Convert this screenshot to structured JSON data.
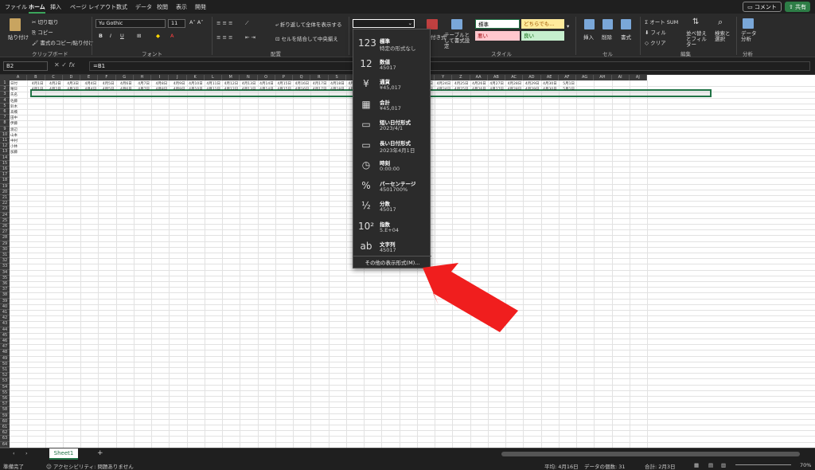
{
  "menu": {
    "tabs": [
      "ファイル",
      "ホーム",
      "挿入",
      "ページ レイアウト",
      "数式",
      "データ",
      "校閲",
      "表示",
      "開発"
    ],
    "active": "ホーム"
  },
  "top_right": {
    "comment": "コメント",
    "share": "共有"
  },
  "ribbon": {
    "clipboard": {
      "paste": "貼り付け",
      "cut": "切り取り",
      "copy": "コピー",
      "format_painter": "書式のコピー/貼り付け",
      "label": "クリップボード"
    },
    "font": {
      "name": "Yu Gothic",
      "size": "11",
      "label": "フォント"
    },
    "alignment": {
      "wrap": "折り返して全体を表示する",
      "merge": "セルを結合して中央揃え",
      "label": "配置"
    },
    "styles": {
      "cond_format_tail": "付き式",
      "table_format": "テーブルとして書式設定",
      "standard": "標準",
      "neutral": "どちらでも...",
      "bad": "悪い",
      "good": "良い",
      "label": "スタイル"
    },
    "cells": {
      "insert": "挿入",
      "delete": "削除",
      "format": "書式",
      "label": "セル"
    },
    "editing": {
      "autosum": "オート SUM",
      "fill": "フィル",
      "clear": "クリア",
      "sort": "並べ替えとフィルター",
      "find": "検索と選択",
      "label": "編集"
    },
    "analysis": {
      "data_analysis": "データ分析",
      "label": "分析"
    }
  },
  "formula_bar": {
    "name_box": "B2",
    "fx": "fx",
    "formula": "=B1"
  },
  "grid": {
    "columns": [
      "A",
      "B",
      "C",
      "D",
      "E",
      "F",
      "G",
      "H",
      "I",
      "J",
      "K",
      "L",
      "M",
      "N",
      "O",
      "P",
      "Q",
      "R",
      "S",
      "T",
      "U",
      "V",
      "W",
      "X",
      "Y",
      "Z",
      "AA",
      "AB",
      "AC",
      "AD",
      "AE",
      "AF",
      "AG",
      "AH",
      "AI",
      "AJ"
    ],
    "dates": [
      "4月1日",
      "4月2日",
      "4月3日",
      "4月4日",
      "4月5日",
      "4月6日",
      "4月7日",
      "4月8日",
      "4月9日",
      "4月10日",
      "4月11日",
      "4月12日",
      "4月13日",
      "4月14日",
      "4月15日",
      "4月16日",
      "4月17日",
      "4月18日",
      "4月19日",
      "4月20日",
      "4月21日",
      "4月22日",
      "4月23日",
      "4月24日",
      "4月25日",
      "4月26日",
      "4月27日",
      "4月28日",
      "4月29日",
      "4月30日",
      "5月1日"
    ],
    "row_labels": [
      "日付",
      "曜日",
      "氏名",
      "佐藤",
      "鈴木",
      "高橋",
      "田中",
      "伊藤",
      "渡辺",
      "山本",
      "中村",
      "小林",
      "加藤"
    ]
  },
  "format_dropdown": {
    "items": [
      {
        "icon": "123",
        "label": "標準",
        "example": "特定の形式なし"
      },
      {
        "icon": "12",
        "label": "数値",
        "example": "45017"
      },
      {
        "icon": "¥",
        "label": "通貨",
        "example": "¥45,017"
      },
      {
        "icon": "▦",
        "label": "会計",
        "example": " ¥45,017"
      },
      {
        "icon": "▭",
        "label": "短い日付形式",
        "example": "2023/4/1"
      },
      {
        "icon": "▭",
        "label": "長い日付形式",
        "example": "2023年4月1日"
      },
      {
        "icon": "◷",
        "label": "時刻",
        "example": "0:00:00"
      },
      {
        "icon": "%",
        "label": "パーセンテージ",
        "example": "4501700%"
      },
      {
        "icon": "½",
        "label": "分数",
        "example": "45017"
      },
      {
        "icon": "10²",
        "label": "指数",
        "example": "5.E+04"
      },
      {
        "icon": "ab",
        "label": "文字列",
        "example": "45017"
      }
    ],
    "more": "その他の表示形式(M)..."
  },
  "sheet_tab": "Sheet1",
  "status": {
    "ready": "準備完了",
    "accessibility": "アクセシビリティ: 問題ありません",
    "average": "平均: 4月16日",
    "count": "データの個数: 31",
    "sum": "合計: 2月3日",
    "zoom": "70%"
  },
  "colors": {
    "accent": "#217346",
    "arrow": "#f01e1e"
  }
}
